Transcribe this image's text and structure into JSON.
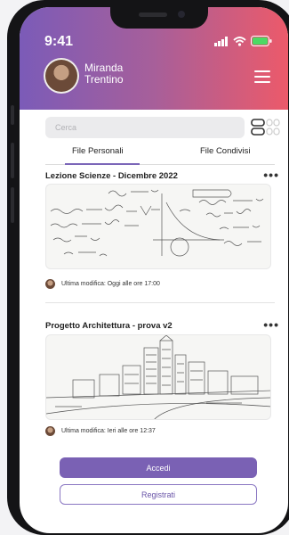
{
  "status_bar": {
    "time": "9:41"
  },
  "profile": {
    "name": "Miranda Trentino"
  },
  "search": {
    "placeholder": "Cerca"
  },
  "tabs": [
    {
      "label": "File Personali",
      "active": true
    },
    {
      "label": "File Condivisi",
      "active": false
    }
  ],
  "files": [
    {
      "title": "Lezione Scienze - Dicembre 2022",
      "modified": "Ultima modifica: Oggi alle ore 17:00",
      "thumbnail": "math-whiteboard-sketch"
    },
    {
      "title": "Progetto Architettura - prova v2",
      "modified": "Ultima modifica: Ieri alle ore 12:37",
      "thumbnail": "city-architecture-sketch"
    }
  ],
  "more_label": "•••",
  "buttons": {
    "primary": "Accedi",
    "secondary": "Registrati"
  },
  "colors": {
    "accent": "#7a61b4",
    "header_start": "#7b5bb8",
    "header_end": "#ec5a6a"
  }
}
